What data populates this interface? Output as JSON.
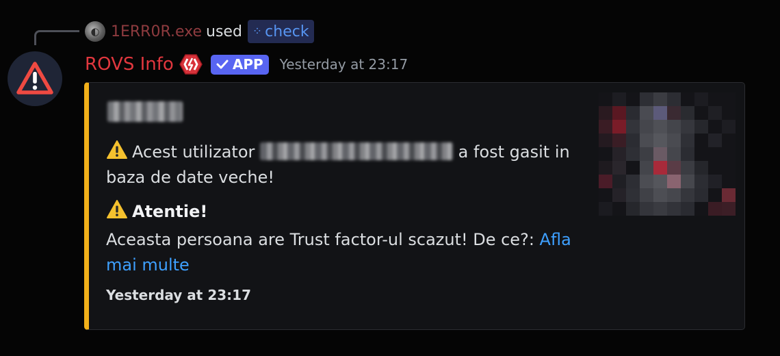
{
  "reply": {
    "username": "1ERR0R.exe",
    "used_text": "used",
    "command": "check"
  },
  "message": {
    "username": "ROVS Info",
    "app_badge": "APP",
    "timestamp": "Yesterday at 23:17"
  },
  "embed": {
    "accent_color": "#f1b01a",
    "description_prefix": "Acest utilizator",
    "description_suffix": "a fost gasit in baza de date veche!",
    "field_title": "Atentie!",
    "field_value": "Aceasta persoana are Trust factor-ul scazut! De ce?:",
    "field_link": "Afla mai multe",
    "footer_timestamp": "Yesterday at 23:17"
  },
  "icons": {
    "avatar": "warning-triangle-icon",
    "role": "hexagon-bolt-icon",
    "badge": "checkmark-icon",
    "command": "command-dots-icon"
  }
}
